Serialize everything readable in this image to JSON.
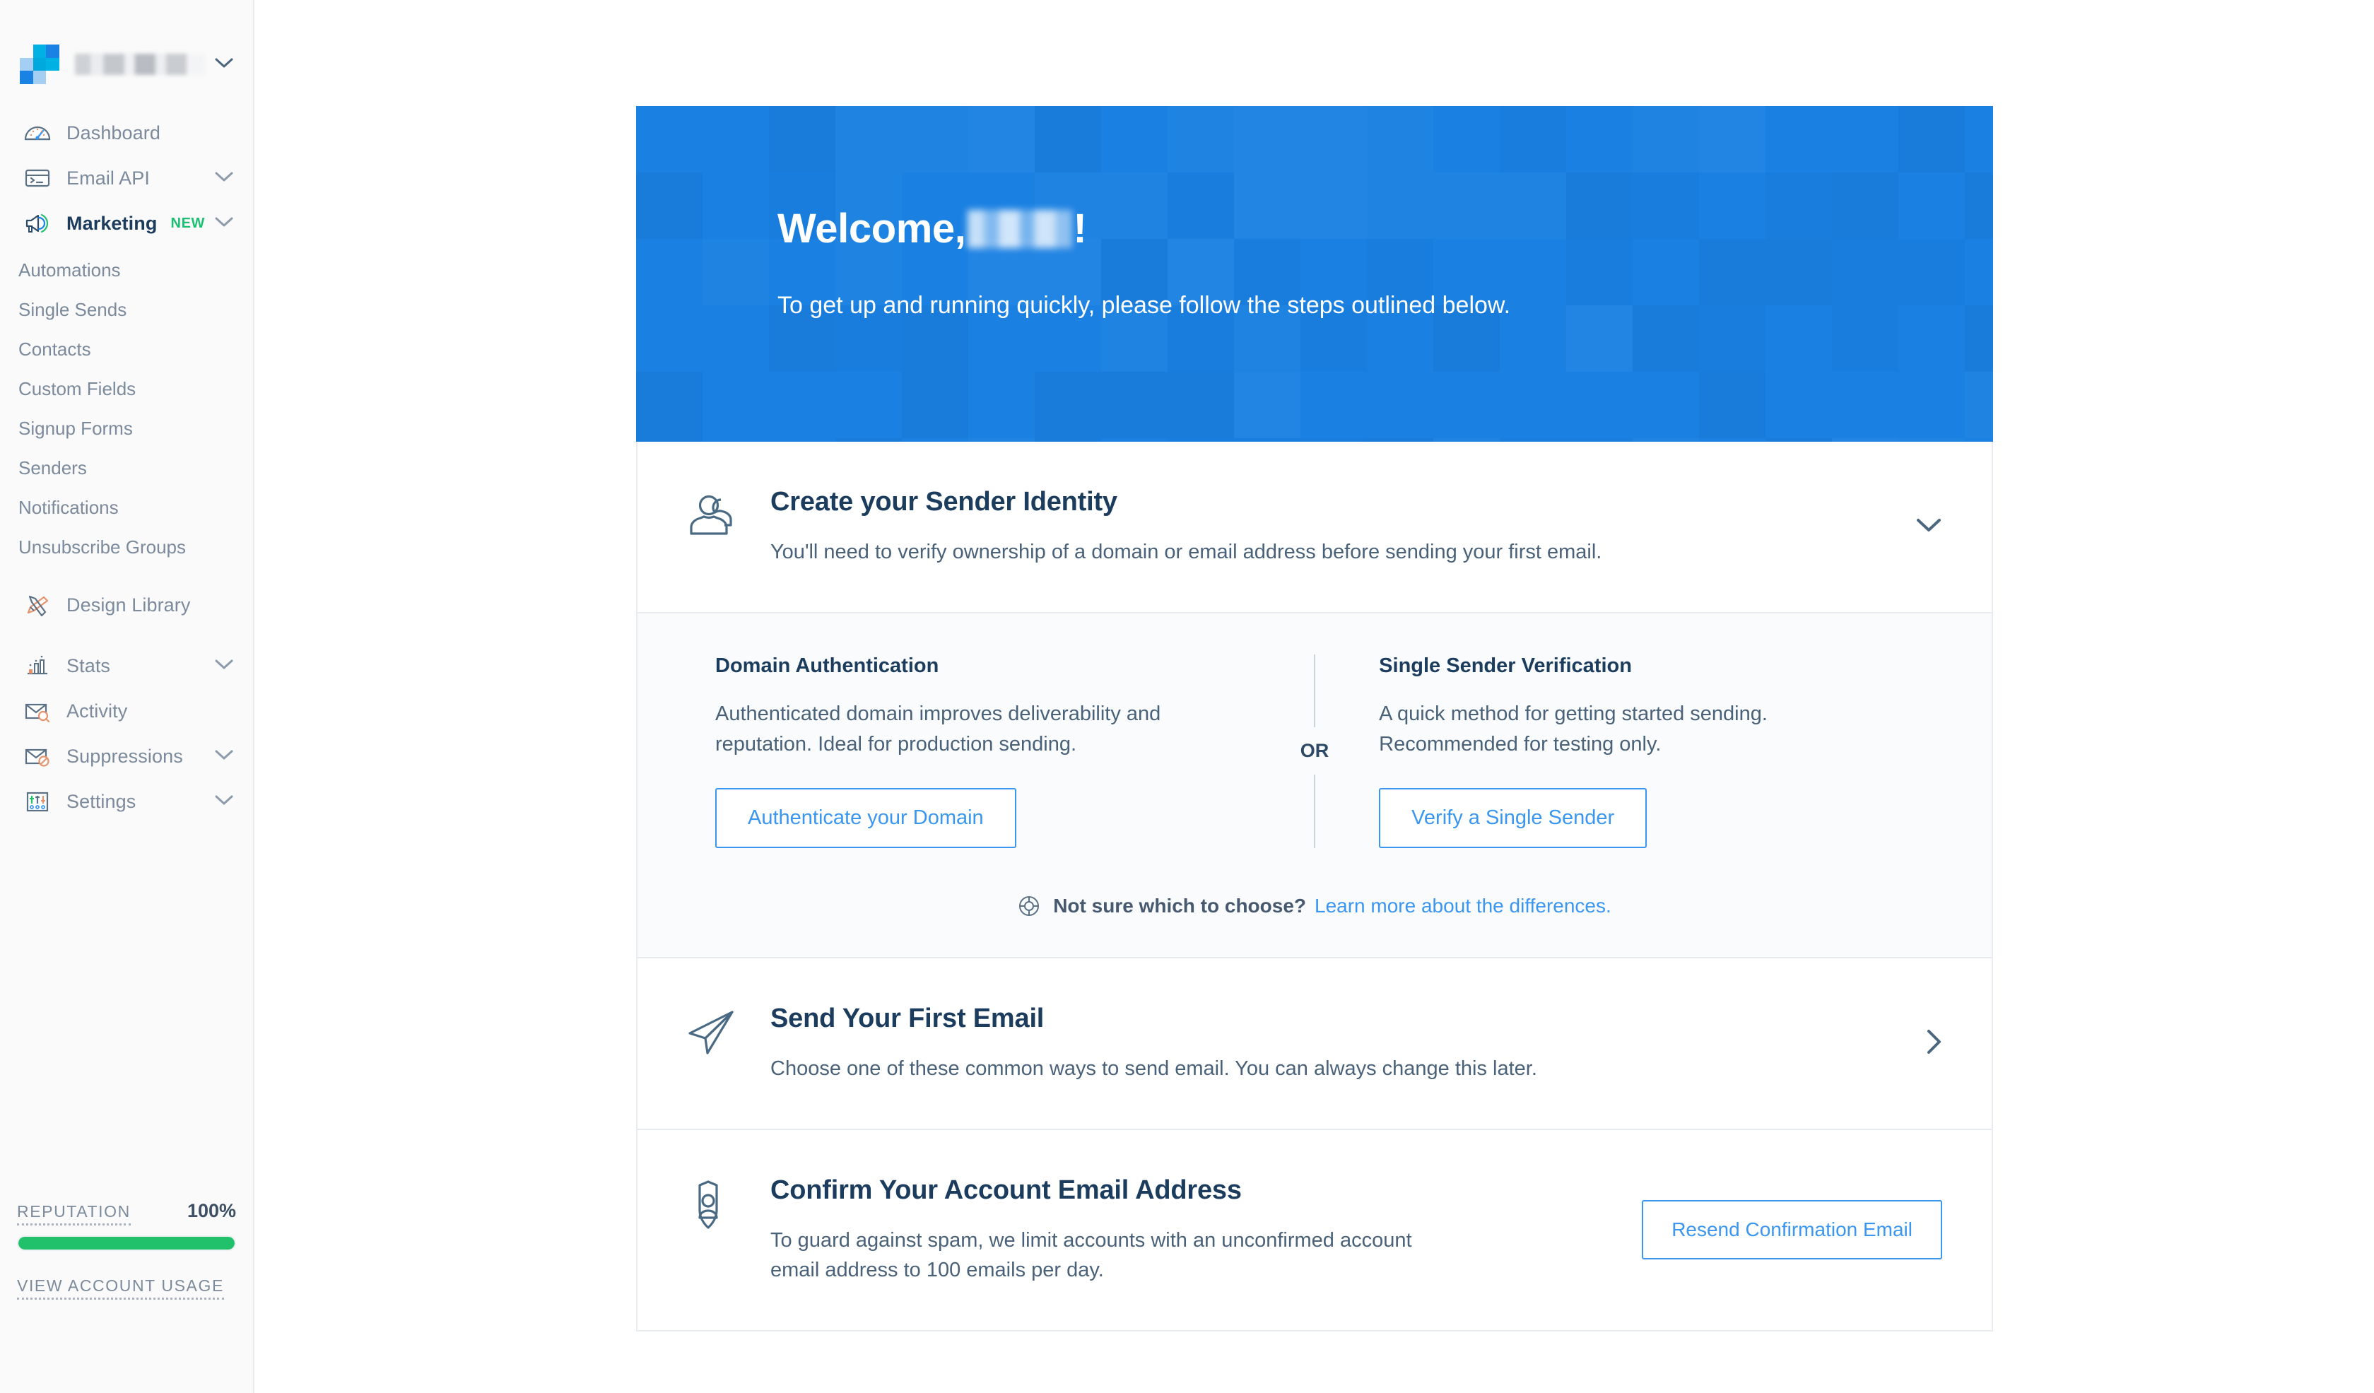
{
  "colors": {
    "brand_blue": "#1a80e2",
    "link_blue": "#3a96ef",
    "navy": "#1c3c5e",
    "muted": "#7b8a9c",
    "green": "#21c06a",
    "new_badge_green": "#1cbf72"
  },
  "sidebar": {
    "account_name": "",
    "account_caret_icon": "chevron-down-icon",
    "logo_icon": "sendgrid-logo-icon",
    "nav": [
      {
        "label": "Dashboard",
        "icon": "gauge-icon",
        "caret": false,
        "active": false
      },
      {
        "label": "Email API",
        "icon": "terminal-icon",
        "caret": true,
        "active": false
      },
      {
        "label": "Marketing",
        "icon": "megaphone-icon",
        "caret": true,
        "active": true,
        "badge": "NEW"
      }
    ],
    "marketing_subitems": [
      "Automations",
      "Single Sends",
      "Contacts",
      "Custom Fields",
      "Signup Forms",
      "Senders",
      "Notifications",
      "Unsubscribe Groups"
    ],
    "nav2": [
      {
        "label": "Design Library",
        "icon": "pencil-ruler-icon",
        "caret": false,
        "active": false
      },
      {
        "label": "Stats",
        "icon": "bar-chart-icon",
        "caret": true,
        "active": false
      },
      {
        "label": "Activity",
        "icon": "envelope-search-icon",
        "caret": false,
        "active": false
      },
      {
        "label": "Suppressions",
        "icon": "envelope-block-icon",
        "caret": true,
        "active": false
      },
      {
        "label": "Settings",
        "icon": "sliders-icon",
        "caret": true,
        "active": false
      }
    ],
    "reputation": {
      "label": "REPUTATION",
      "value": "100%",
      "percent": 100
    },
    "account_usage_link": "VIEW ACCOUNT USAGE"
  },
  "hero": {
    "greeting_prefix": "Welcome,",
    "greeting_suffix": "!",
    "name_redacted": true,
    "subtitle": "To get up and running quickly, please follow the steps outlined below."
  },
  "sections": {
    "sender_identity": {
      "icon": "users-icon",
      "title": "Create your Sender Identity",
      "description": "You'll need to verify ownership of a domain or email address before sending your first email.",
      "chevron_icon": "chevron-down-icon",
      "expanded": true,
      "options": [
        {
          "heading": "Domain Authentication",
          "body": "Authenticated domain improves deliverability and reputation. Ideal for production sending.",
          "button": "Authenticate your Domain"
        },
        {
          "heading": "Single Sender Verification",
          "body": "A quick method for getting started sending. Recommended for testing only.",
          "button": "Verify a Single Sender"
        }
      ],
      "divider_text": "OR",
      "helper": {
        "icon": "lifebuoy-icon",
        "question": "Not sure which to choose?",
        "link_text": "Learn more about the differences."
      }
    },
    "first_email": {
      "icon": "paper-plane-icon",
      "title": "Send Your First Email",
      "description": "Choose one of these common ways to send email. You can always change this later.",
      "chevron_icon": "chevron-right-icon"
    },
    "confirm_email": {
      "icon": "shield-person-icon",
      "title": "Confirm Your Account Email Address",
      "description": "To guard against spam, we limit accounts with an unconfirmed account email address to 100 emails per day.",
      "button": "Resend Confirmation Email"
    }
  }
}
